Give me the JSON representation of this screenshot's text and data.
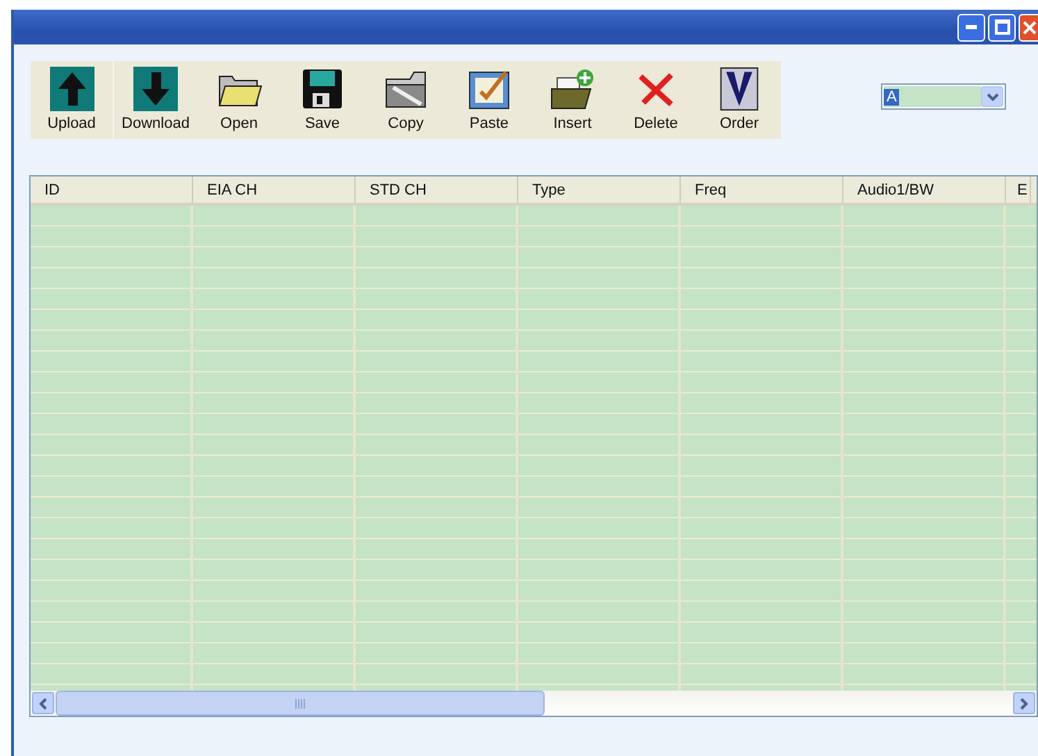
{
  "toolbar": [
    {
      "kind": "upload",
      "label": "Upload"
    },
    {
      "kind": "download",
      "label": "Download"
    },
    {
      "kind": "open",
      "label": "Open"
    },
    {
      "kind": "save",
      "label": "Save"
    },
    {
      "kind": "copy",
      "label": "Copy"
    },
    {
      "kind": "paste",
      "label": "Paste"
    },
    {
      "kind": "insert",
      "label": "Insert"
    },
    {
      "kind": "delete",
      "label": "Delete"
    },
    {
      "kind": "order",
      "label": "Order"
    }
  ],
  "dropdown": {
    "value": "A"
  },
  "table": {
    "columns": [
      "ID",
      "EIA CH",
      "STD CH",
      "Type",
      "Freq",
      "Audio1/BW",
      "E"
    ]
  }
}
